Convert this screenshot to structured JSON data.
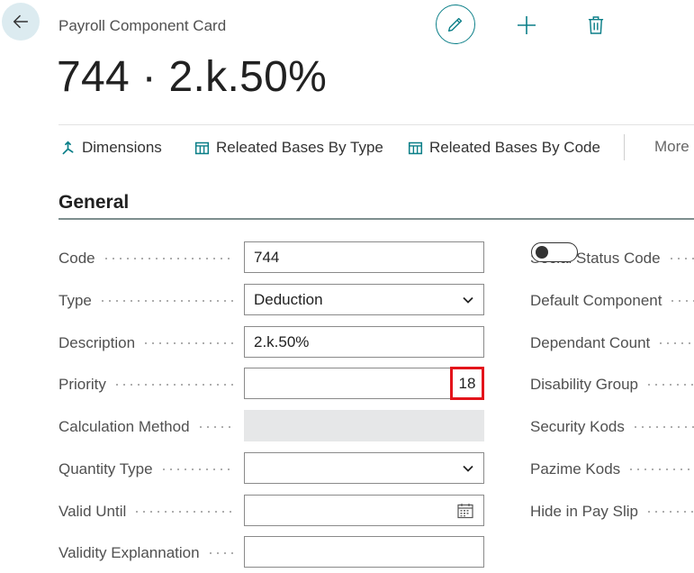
{
  "header": {
    "page_caption": "Payroll Component Card",
    "record_title": "744 · 2.k.50%"
  },
  "actions": [
    {
      "label": "Dimensions",
      "icon": "dimensions-icon"
    },
    {
      "label": "Releated Bases By Type",
      "icon": "table-icon"
    },
    {
      "label": "Releated Bases By Code",
      "icon": "table-icon"
    }
  ],
  "more_label": "More",
  "section": {
    "title": "General"
  },
  "left_fields": {
    "code": {
      "label": "Code",
      "value": "744"
    },
    "type": {
      "label": "Type",
      "value": "Deduction"
    },
    "description": {
      "label": "Description",
      "value": "2.k.50%"
    },
    "priority": {
      "label": "Priority",
      "value": "18"
    },
    "calculation_method": {
      "label": "Calculation Method",
      "value": ""
    },
    "quantity_type": {
      "label": "Quantity Type",
      "value": ""
    },
    "valid_until": {
      "label": "Valid Until",
      "value": ""
    },
    "validity_explanation": {
      "label": "Validity Explannation",
      "value": ""
    }
  },
  "right_fields": {
    "social_status_code": {
      "label": "Social Status Code",
      "value": false
    },
    "default_component": {
      "label": "Default Component"
    },
    "dependant_count": {
      "label": "Dependant Count"
    },
    "disability_group": {
      "label": "Disability Group"
    },
    "security_kods": {
      "label": "Security Kods"
    },
    "pazime_kods": {
      "label": "Pazime Kods"
    },
    "hide_in_pay_slip": {
      "label": "Hide in Pay Slip"
    }
  },
  "colors": {
    "accent": "#0b7f88",
    "highlight": "#e3141b",
    "back_bg": "#dcebf0"
  }
}
